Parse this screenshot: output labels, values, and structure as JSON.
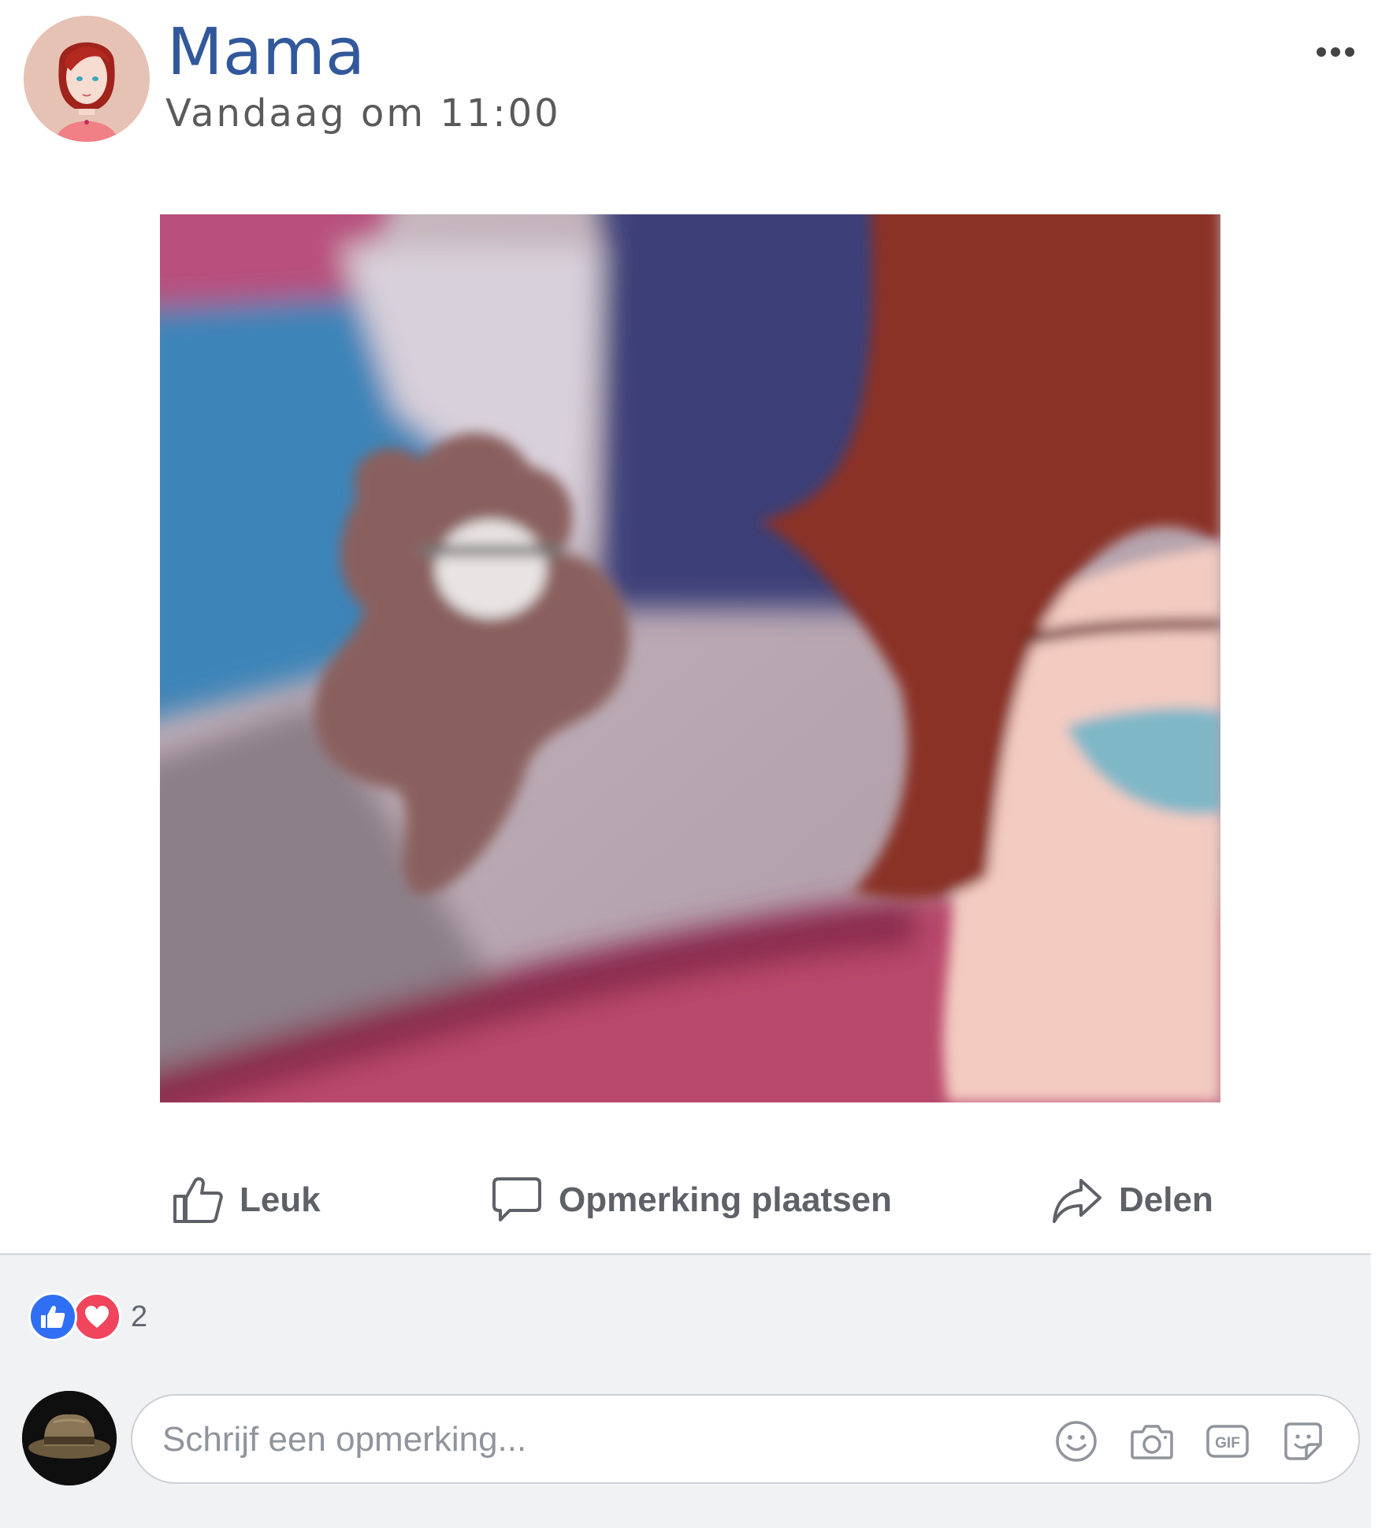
{
  "post": {
    "author": "Mama",
    "timestamp": "Vandaag om 11:00",
    "more_icon": "more-options-icon"
  },
  "actions": {
    "like_label": "Leuk",
    "comment_label": "Opmerking plaatsen",
    "share_label": "Delen"
  },
  "reactions": {
    "types": [
      "like",
      "love"
    ],
    "count": "2"
  },
  "comment_composer": {
    "placeholder": "Schrijf een opmerking...",
    "icons": [
      "emoji-icon",
      "camera-icon",
      "gif-icon",
      "sticker-icon"
    ]
  },
  "colors": {
    "author_blue": "#31589b",
    "like_blue": "#2f6ff4",
    "love_red": "#f0455c",
    "footer_bg": "#f1f2f4"
  }
}
